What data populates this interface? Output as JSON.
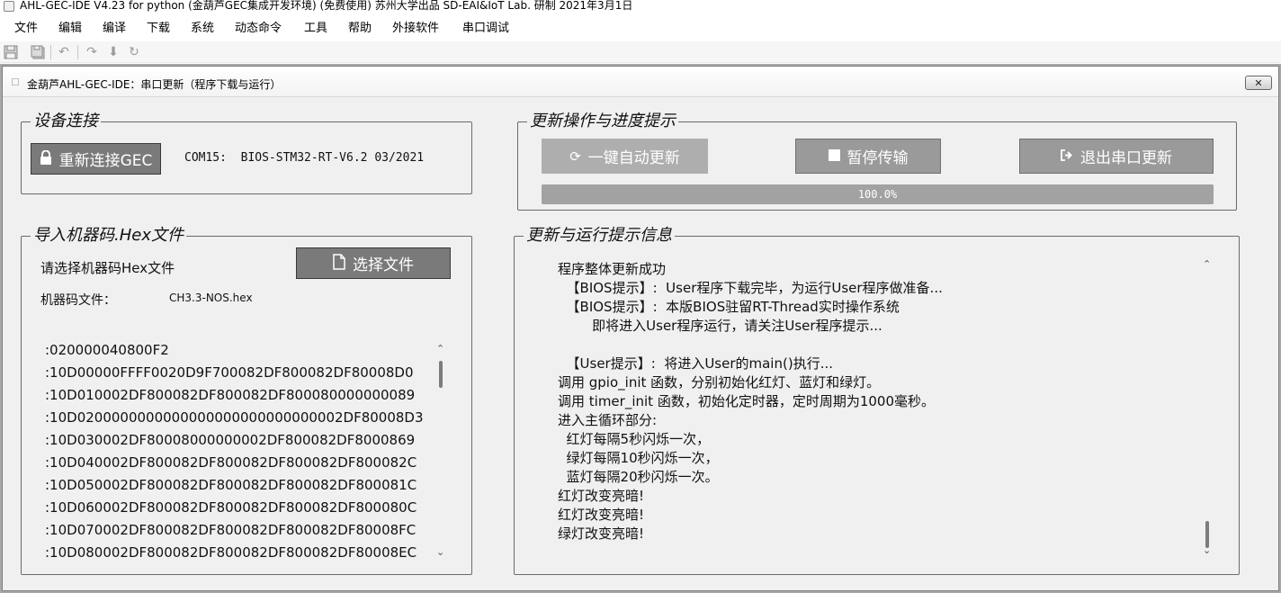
{
  "window": {
    "title": "AHL-GEC-IDE V4.23 for python (金葫芦GEC集成开发环境)  (免费使用)  苏州大学出品 SD-EAI&IoT Lab. 研制    2021年3月1日"
  },
  "menu": {
    "items": [
      "文件",
      "编辑",
      "编译",
      "下载",
      "系统",
      "动态命令",
      "工具",
      "帮助",
      "外接软件",
      "串口调试"
    ]
  },
  "toolbar": {
    "icons": [
      "save-icon",
      "save-all-icon",
      "undo-icon",
      "redo-icon",
      "download-icon",
      "refresh-icon"
    ]
  },
  "dialog": {
    "title": "金葫芦AHL-GEC-IDE：串口更新（程序下载与运行）",
    "close_label": "✕"
  },
  "device": {
    "group_title": "设备连接",
    "reconnect_label": "重新连接GEC",
    "status": "COM15:  BIOS-STM32-RT-V6.2 03/2021"
  },
  "update": {
    "group_title": "更新操作与进度提示",
    "auto_update_label": "一键自动更新",
    "pause_label": "暂停传输",
    "exit_label": "退出串口更新",
    "progress": 1.0,
    "progress_text": "100.0%"
  },
  "hex": {
    "group_title": "导入机器码.Hex文件",
    "prompt": "请选择机器码Hex文件",
    "choose_label": "选择文件",
    "file_label": "机器码文件：",
    "file_name": "CH3.3-NOS.hex",
    "lines": [
      ":020000040800F2",
      ":10D00000FFFF0020D9F700082DF800082DF80008D0",
      ":10D010002DF800082DF800082DF800080000000089",
      ":10D0200000000000000000000000000002DF80008D3",
      ":10D030002DF80008000000002DF800082DF8000869",
      ":10D040002DF800082DF800082DF800082DF800082C",
      ":10D050002DF800082DF800082DF800082DF800081C",
      ":10D060002DF800082DF800082DF800082DF800080C",
      ":10D070002DF800082DF800082DF800082DF80008FC",
      ":10D080002DF800082DF800082DF800082DF80008EC"
    ]
  },
  "messages": {
    "group_title": "更新与运行提示信息",
    "lines": [
      "程序整体更新成功",
      "  【BIOS提示】:  User程序下载完毕，为运行User程序做准备...",
      "  【BIOS提示】:  本版BIOS驻留RT-Thread实时操作系统",
      "        即将进入User程序运行，请关注User程序提示...",
      "",
      "  【User提示】:  将进入User的main()执行...",
      "调用 gpio_init 函数，分别初始化红灯、蓝灯和绿灯。",
      "调用 timer_init 函数，初始化定时器，定时周期为1000毫秒。",
      "进入主循环部分:",
      "  红灯每隔5秒闪烁一次，",
      "  绿灯每隔10秒闪烁一次，",
      "  蓝灯每隔20秒闪烁一次。",
      "红灯改变亮暗!",
      "红灯改变亮暗!",
      "绿灯改变亮暗!"
    ]
  }
}
